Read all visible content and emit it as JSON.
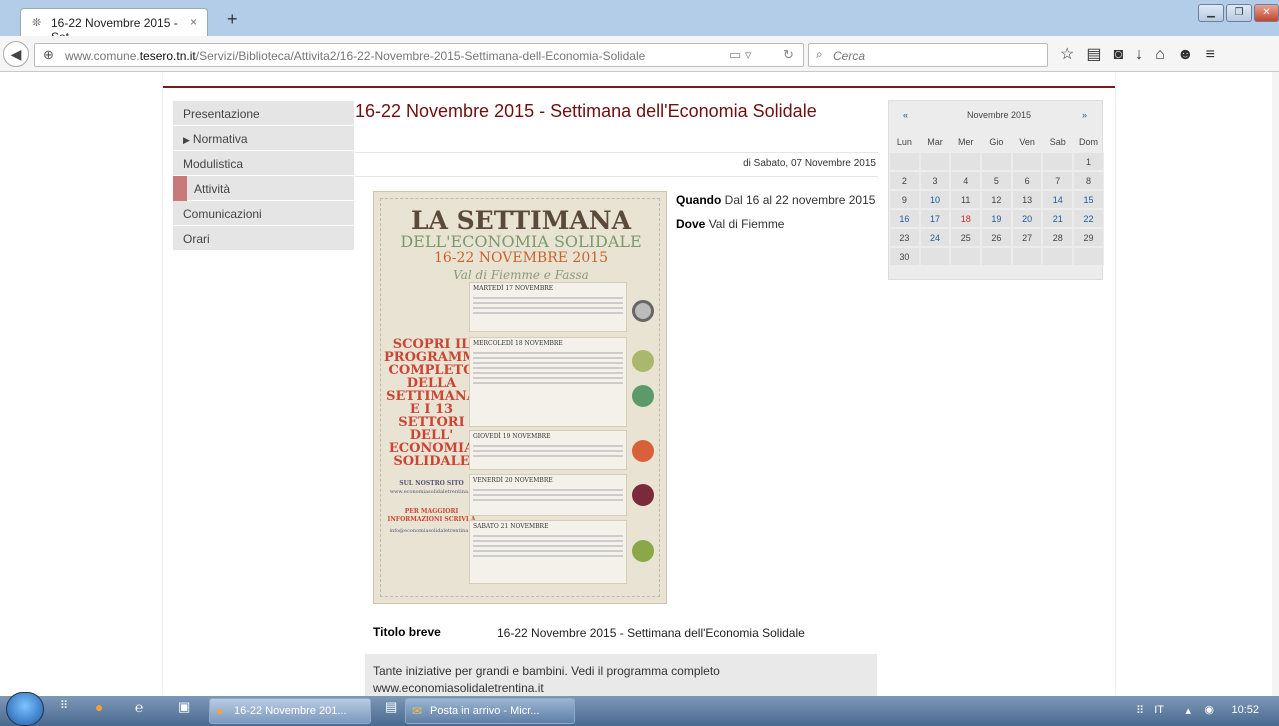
{
  "browser": {
    "tab_title": "16-22 Novembre 2015 - Set...",
    "tab_close": "×",
    "new_tab": "+",
    "url_prefix": "www.comune.",
    "url_domain": "tesero.tn.it",
    "url_path": "/Servizi/Biblioteca/Attivita2/16-22-Novembre-2015-Settimana-dell-Economia-Solidale",
    "search_placeholder": "Cerca"
  },
  "menu": {
    "items": [
      {
        "label": "Presentazione"
      },
      {
        "label": "Normativa"
      },
      {
        "label": "Modulistica"
      },
      {
        "label": "Attività"
      },
      {
        "label": "Comunicazioni"
      },
      {
        "label": "Orari"
      }
    ]
  },
  "article": {
    "title": "16-22 Novembre 2015 - Settimana dell'Economia Solidale",
    "date": "di Sabato, 07 Novembre 2015",
    "when_label": "Quando",
    "when_value": "Dal 16 al 22 novembre 2015",
    "where_label": "Dove",
    "where_value": "Val di Fiemme",
    "short_title_label": "Titolo breve",
    "short_title_value": "16-22 Novembre 2015 - Settimana dell'Economia Solidale",
    "description": "Tante iniziative per grandi e bambini. Vedi il programma completo www.economiasolidaletrentina.it"
  },
  "poster": {
    "line1": "LA SETTIMANA",
    "line2": "DELL'ECONOMIA SOLIDALE",
    "line3": "16-22 NOVEMBRE 2015",
    "line4": "Val di Fiemme e Fassa",
    "left_text": "SCOPRI IL PROGRAMMA COMPLETO DELLA SETTIMANA E I 13 SETTORI DELL' ECONOMIA SOLIDALE",
    "site_label": "SUL NOSTRO SITO",
    "site_url": "www.economiasolidaletrentina.it",
    "info_label": "PER MAGGIORI INFORMAZIONI SCRIVI A",
    "info_mail": "info@economiasolidaletrentina.it",
    "days": [
      "MARTEDÌ 17 NOVEMBRE",
      "MERCOLEDÌ 18 NOVEMBRE",
      "GIOVEDÌ 19 NOVEMBRE",
      "VENERDÌ 20 NOVEMBRE",
      "SABATO 21 NOVEMBRE"
    ]
  },
  "calendar": {
    "prev": "«",
    "next": "»",
    "month": "Novembre 2015",
    "weekdays": [
      "Lun",
      "Mar",
      "Mer",
      "Gio",
      "Ven",
      "Sab",
      "Dom"
    ],
    "weeks": [
      [
        "",
        "",
        "",
        "",
        "",
        "",
        "1"
      ],
      [
        "2",
        "3",
        "4",
        "5",
        "6",
        "7",
        "8"
      ],
      [
        "9",
        "10",
        "11",
        "12",
        "13",
        "14",
        "15"
      ],
      [
        "16",
        "17",
        "18",
        "19",
        "20",
        "21",
        "22"
      ],
      [
        "23",
        "24",
        "25",
        "26",
        "27",
        "28",
        "29"
      ],
      [
        "30",
        "",
        "",
        "",
        "",
        "",
        ""
      ]
    ],
    "link_days": [
      "10",
      "14",
      "15",
      "16",
      "17",
      "19",
      "20",
      "21",
      "22",
      "24"
    ],
    "today": "18"
  },
  "taskbar": {
    "firefox_task": "16-22 Novembre 201...",
    "outlook_task": "Posta in arrivo - Micr...",
    "lang": "IT",
    "clock": "10:52"
  },
  "colors": {
    "title": "#6f0f0f",
    "link": "#1c5a9a",
    "today": "#c62b2b",
    "menu_marker": "#c87979"
  }
}
